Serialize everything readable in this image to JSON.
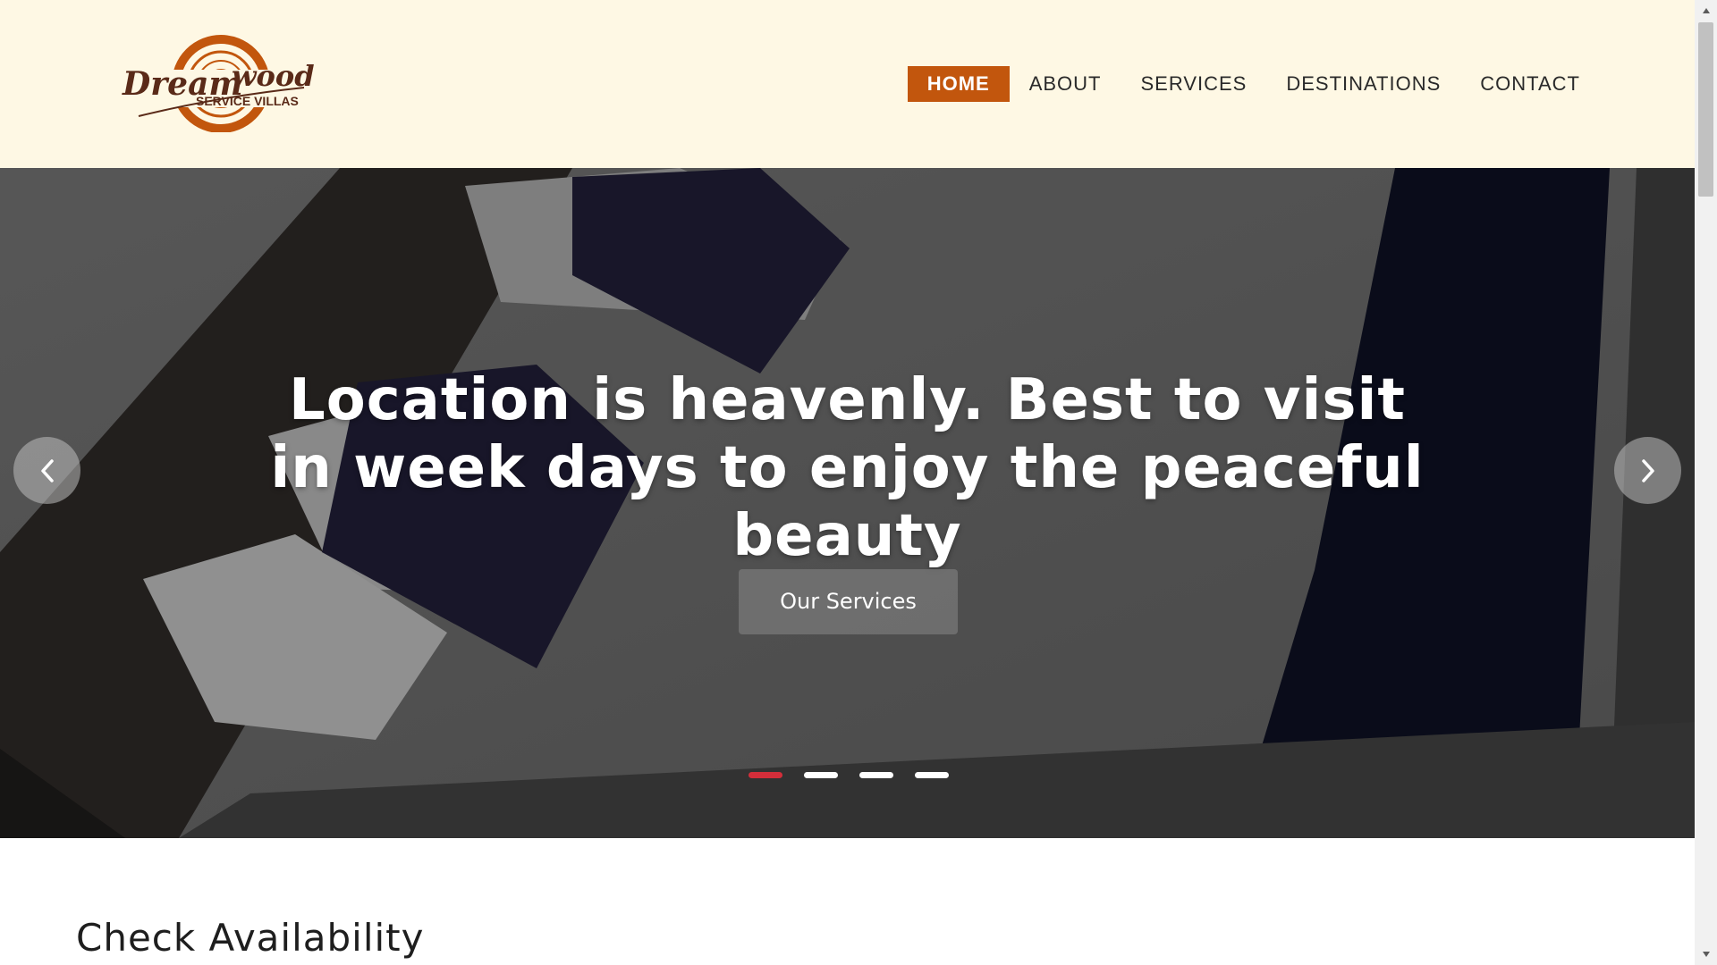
{
  "logo": {
    "text_main": "Dream wood",
    "text_sub": "SERVICE VILLAS",
    "brand_color": "#c2560d",
    "text_color": "#5a2a18"
  },
  "nav": {
    "items": [
      {
        "label": "HOME",
        "active": true
      },
      {
        "label": "ABOUT",
        "active": false
      },
      {
        "label": "SERVICES",
        "active": false
      },
      {
        "label": "DESTINATIONS",
        "active": false
      },
      {
        "label": "CONTACT",
        "active": false
      }
    ],
    "active_color": "#c2560d"
  },
  "hero": {
    "title": "Location is heavenly. Best to visit in week days to enjoy the peaceful beauty",
    "button_label": "Our Services",
    "prev_icon": "chevron-left-icon",
    "next_icon": "chevron-right-icon",
    "slide_count": 4,
    "active_slide": 1,
    "indicator_active_color": "#d42e3a"
  },
  "availability": {
    "title": "Check Availability"
  },
  "scrollbar": {
    "up_icon": "triangle-up-icon",
    "down_icon": "triangle-down-icon"
  },
  "colors": {
    "header_bg": "#fef8e4"
  }
}
